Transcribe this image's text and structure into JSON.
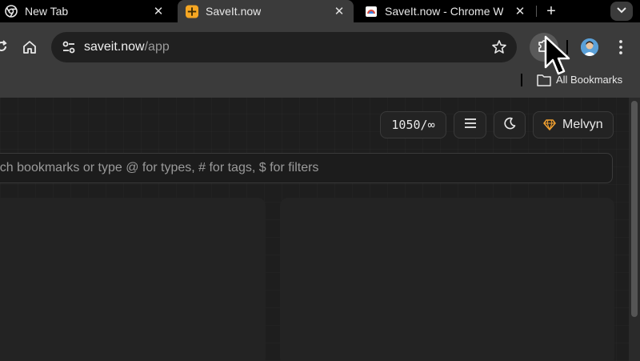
{
  "tabs": [
    {
      "title": "New Tab",
      "icon": "chrome-icon",
      "active": false
    },
    {
      "title": "SaveIt.now",
      "icon": "saveit-icon",
      "active": true
    },
    {
      "title": "SaveIt.now - Chrome Web Store",
      "icon": "web-store-icon",
      "active": false
    }
  ],
  "new_tab_label": "+",
  "address_bar": {
    "host": "saveit.now",
    "path": "/app"
  },
  "bookmarks_bar": {
    "all_bookmarks_label": "All Bookmarks"
  },
  "app": {
    "bookmark_count": "1050/∞",
    "user_name": "Melvyn",
    "search_placeholder": "Search bookmarks or type @ for types, # for tags, $ for filters"
  },
  "icons": {
    "reload": "reload-icon",
    "home": "home-icon",
    "site_settings": "tune-icon",
    "star": "star-icon",
    "extensions": "puzzle-icon",
    "menu": "more-vert-icon",
    "folder": "folder-icon",
    "list": "list-icon",
    "theme": "moon-icon",
    "plan": "diamond-icon"
  },
  "colors": {
    "saveit_brand": "#f5a623",
    "plan_diamond": "#f0a030",
    "tab_active_bg": "#3b3b3b"
  }
}
